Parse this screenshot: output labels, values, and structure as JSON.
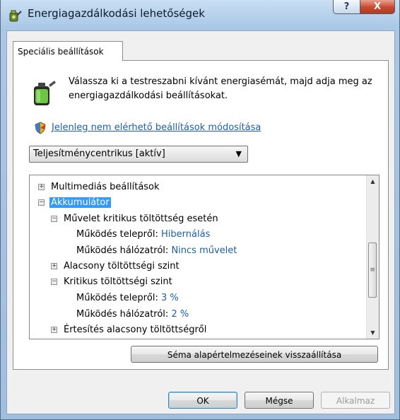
{
  "window": {
    "title": "Energiagazdálkodási lehetőségek",
    "help_label": "?",
    "close_label": "X"
  },
  "tab": {
    "label": "Speciális beállítások"
  },
  "description": "Válassza ki a testreszabni kívánt energiasémát, majd adja meg az energiagazdálkodási beállításokat.",
  "change_link": "Jelenleg nem elérhető beállítások módosítása",
  "plan_select": {
    "value": "Teljesítménycentrikus [aktív]"
  },
  "tree": {
    "multimedia": "Multimediás beállítások",
    "battery": "Akkumulátor",
    "critical_action": "Művelet kritikus töltöttség esetén",
    "on_battery_label": "Működés telepről:",
    "plugged_in_label": "Működés hálózatról:",
    "critical_action_on_battery": "Hibernálás",
    "critical_action_plugged_in": "Nincs művelet",
    "low_level": "Alacsony töltöttségi szint",
    "critical_level": "Kritikus töltöttségi szint",
    "critical_level_on_battery": "3 %",
    "critical_level_plugged_in": "2 %",
    "low_notification": "Értesítés alacsony töltöttségről"
  },
  "buttons": {
    "restore_defaults": "Séma alapértelmezéseinek visszaállítása",
    "ok": "OK",
    "cancel": "Mégse",
    "apply": "Alkalmaz"
  },
  "colors": {
    "link": "#1a5fb4",
    "selection": "#3399ff",
    "close_button": "#c74a2f"
  }
}
